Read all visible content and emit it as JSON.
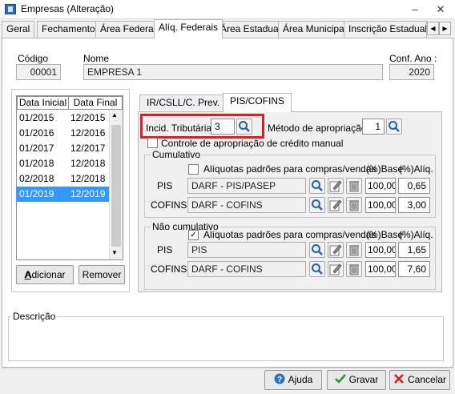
{
  "window": {
    "title": "Empresas (Alteração)",
    "minimize": "–",
    "close": "✕"
  },
  "tabs": [
    "Geral",
    "Fechamento",
    "Área Federal",
    "Alíq. Federais",
    "Área Estadual",
    "Área Municipal",
    "Inscrição Estadual S"
  ],
  "tab_nav": {
    "prev": "◀",
    "next": "▶"
  },
  "header": {
    "codigo_label": "Código",
    "codigo_value": "00001",
    "nome_label": "Nome",
    "nome_value": "EMPRESA 1",
    "conf_ano_label": "Conf. Ano :",
    "conf_ano_value": "2020"
  },
  "period_list": {
    "headers": [
      "Data Inicial",
      "Data Final"
    ],
    "rows": [
      [
        "01/2015",
        "12/2015"
      ],
      [
        "01/2016",
        "12/2016"
      ],
      [
        "01/2017",
        "12/2017"
      ],
      [
        "01/2018",
        "12/2018"
      ],
      [
        "02/2018",
        "12/2018"
      ],
      [
        "01/2019",
        "12/2019"
      ]
    ],
    "selected_index": 5,
    "add_button": "Adicionar",
    "remove_button": "Remover"
  },
  "subtabs": [
    "IR/CSLL/C. Prev.",
    "PIS/COFINS"
  ],
  "pis_cofins": {
    "incid_label": "Incid. Tributária:",
    "incid_value": "3",
    "metodo_label": "Método de apropriação:",
    "metodo_value": "1",
    "controle_label": "Controle de apropriação de crédito manual",
    "cumulativo": {
      "title": "Cumulativo",
      "aliquotas_label": "Alíquotas padrões para compras/vendas",
      "aliquotas_checked": false,
      "base_header": "(%)Base",
      "aliq_header": "(%)Alíq.",
      "rows": [
        {
          "name": "PIS",
          "darf": "DARF - PIS/PASEP",
          "base": "100,00",
          "aliq": "0,65"
        },
        {
          "name": "COFINS",
          "darf": "DARF - COFINS",
          "base": "100,00",
          "aliq": "3,00"
        }
      ]
    },
    "nao_cumulativo": {
      "title": "Não cumulativo",
      "aliquotas_label": "Alíquotas padrões para compras/vendas",
      "aliquotas_checked": true,
      "base_header": "(%)Base",
      "aliq_header": "(%)Alíq.",
      "rows": [
        {
          "name": "PIS",
          "darf": "PIS",
          "base": "100,00",
          "aliq": "1,65"
        },
        {
          "name": "COFINS",
          "darf": "DARF - COFINS",
          "base": "100,00",
          "aliq": "7,60"
        }
      ]
    }
  },
  "descricao_label": "Descrição",
  "footer": {
    "ajuda": "Ajuda",
    "gravar": "Gravar",
    "cancelar": "Cancelar"
  },
  "colors": {
    "selection": "#3399ff",
    "highlight_box": "#e21c22"
  }
}
